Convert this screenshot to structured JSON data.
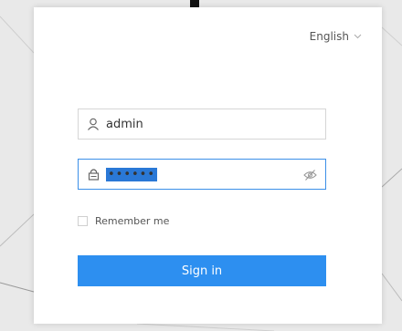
{
  "language_selector": {
    "label": "English"
  },
  "username_field": {
    "value": "admin"
  },
  "password_field": {
    "masked_value": "••••••"
  },
  "remember_me": {
    "label": "Remember me",
    "checked": false
  },
  "sign_in_button": {
    "label": "Sign in"
  },
  "colors": {
    "primary": "#2d8ff0",
    "focus_border": "#3b8fe8",
    "selection": "#2a78d6"
  }
}
